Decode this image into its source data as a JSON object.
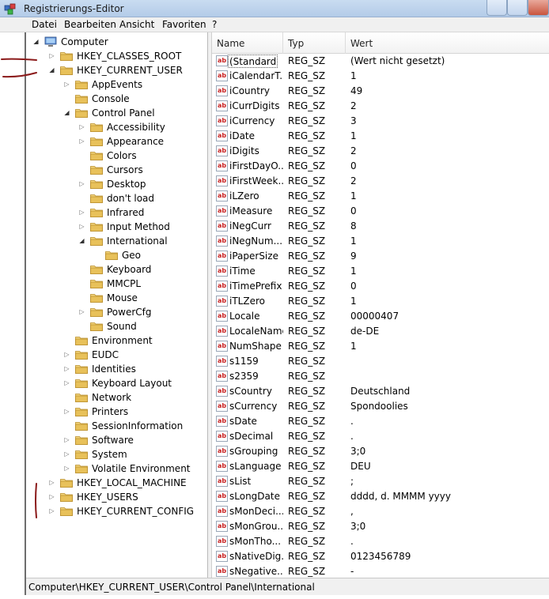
{
  "window": {
    "title": "Registrierungs-Editor"
  },
  "menu": [
    "Datei",
    "Bearbeiten",
    "Ansicht",
    "Favoriten",
    "?"
  ],
  "tree": [
    {
      "label": "Computer",
      "depth": 0,
      "expander": "open",
      "icon": "computer-icon"
    },
    {
      "label": "HKEY_CLASSES_ROOT",
      "depth": 1,
      "expander": "closed",
      "icon": "folder-icon"
    },
    {
      "label": "HKEY_CURRENT_USER",
      "depth": 1,
      "expander": "open",
      "icon": "folder-icon"
    },
    {
      "label": "AppEvents",
      "depth": 2,
      "expander": "closed",
      "icon": "folder-icon"
    },
    {
      "label": "Console",
      "depth": 2,
      "expander": "none",
      "icon": "folder-icon"
    },
    {
      "label": "Control Panel",
      "depth": 2,
      "expander": "open",
      "icon": "folder-icon"
    },
    {
      "label": "Accessibility",
      "depth": 3,
      "expander": "closed",
      "icon": "folder-icon"
    },
    {
      "label": "Appearance",
      "depth": 3,
      "expander": "closed",
      "icon": "folder-icon"
    },
    {
      "label": "Colors",
      "depth": 3,
      "expander": "none",
      "icon": "folder-icon"
    },
    {
      "label": "Cursors",
      "depth": 3,
      "expander": "none",
      "icon": "folder-icon"
    },
    {
      "label": "Desktop",
      "depth": 3,
      "expander": "closed",
      "icon": "folder-icon"
    },
    {
      "label": "don't load",
      "depth": 3,
      "expander": "none",
      "icon": "folder-icon"
    },
    {
      "label": "Infrared",
      "depth": 3,
      "expander": "closed",
      "icon": "folder-icon"
    },
    {
      "label": "Input Method",
      "depth": 3,
      "expander": "closed",
      "icon": "folder-icon"
    },
    {
      "label": "International",
      "depth": 3,
      "expander": "open",
      "icon": "folder-icon"
    },
    {
      "label": "Geo",
      "depth": 4,
      "expander": "none",
      "icon": "folder-icon"
    },
    {
      "label": "Keyboard",
      "depth": 3,
      "expander": "none",
      "icon": "folder-icon"
    },
    {
      "label": "MMCPL",
      "depth": 3,
      "expander": "none",
      "icon": "folder-icon"
    },
    {
      "label": "Mouse",
      "depth": 3,
      "expander": "none",
      "icon": "folder-icon"
    },
    {
      "label": "PowerCfg",
      "depth": 3,
      "expander": "closed",
      "icon": "folder-icon"
    },
    {
      "label": "Sound",
      "depth": 3,
      "expander": "none",
      "icon": "folder-icon"
    },
    {
      "label": "Environment",
      "depth": 2,
      "expander": "none",
      "icon": "folder-icon"
    },
    {
      "label": "EUDC",
      "depth": 2,
      "expander": "closed",
      "icon": "folder-icon"
    },
    {
      "label": "Identities",
      "depth": 2,
      "expander": "closed",
      "icon": "folder-icon"
    },
    {
      "label": "Keyboard Layout",
      "depth": 2,
      "expander": "closed",
      "icon": "folder-icon"
    },
    {
      "label": "Network",
      "depth": 2,
      "expander": "none",
      "icon": "folder-icon"
    },
    {
      "label": "Printers",
      "depth": 2,
      "expander": "closed",
      "icon": "folder-icon"
    },
    {
      "label": "SessionInformation",
      "depth": 2,
      "expander": "none",
      "icon": "folder-icon"
    },
    {
      "label": "Software",
      "depth": 2,
      "expander": "closed",
      "icon": "folder-icon"
    },
    {
      "label": "System",
      "depth": 2,
      "expander": "closed",
      "icon": "folder-icon"
    },
    {
      "label": "Volatile Environment",
      "depth": 2,
      "expander": "closed",
      "icon": "folder-icon"
    },
    {
      "label": "HKEY_LOCAL_MACHINE",
      "depth": 1,
      "expander": "closed",
      "icon": "folder-icon"
    },
    {
      "label": "HKEY_USERS",
      "depth": 1,
      "expander": "closed",
      "icon": "folder-icon"
    },
    {
      "label": "HKEY_CURRENT_CONFIG",
      "depth": 1,
      "expander": "closed",
      "icon": "folder-icon"
    }
  ],
  "list": {
    "columns": [
      "Name",
      "Typ",
      "Wert"
    ],
    "rows": [
      {
        "name": "(Standard)",
        "type": "REG_SZ",
        "value": "(Wert nicht gesetzt)"
      },
      {
        "name": "iCalendarT...",
        "type": "REG_SZ",
        "value": "1"
      },
      {
        "name": "iCountry",
        "type": "REG_SZ",
        "value": "49"
      },
      {
        "name": "iCurrDigits",
        "type": "REG_SZ",
        "value": "2"
      },
      {
        "name": "iCurrency",
        "type": "REG_SZ",
        "value": "3"
      },
      {
        "name": "iDate",
        "type": "REG_SZ",
        "value": "1"
      },
      {
        "name": "iDigits",
        "type": "REG_SZ",
        "value": "2"
      },
      {
        "name": "iFirstDayO...",
        "type": "REG_SZ",
        "value": "0"
      },
      {
        "name": "iFirstWeek...",
        "type": "REG_SZ",
        "value": "2"
      },
      {
        "name": "iLZero",
        "type": "REG_SZ",
        "value": "1"
      },
      {
        "name": "iMeasure",
        "type": "REG_SZ",
        "value": "0"
      },
      {
        "name": "iNegCurr",
        "type": "REG_SZ",
        "value": "8"
      },
      {
        "name": "iNegNum...",
        "type": "REG_SZ",
        "value": "1"
      },
      {
        "name": "iPaperSize",
        "type": "REG_SZ",
        "value": "9"
      },
      {
        "name": "iTime",
        "type": "REG_SZ",
        "value": "1"
      },
      {
        "name": "iTimePrefix",
        "type": "REG_SZ",
        "value": "0"
      },
      {
        "name": "iTLZero",
        "type": "REG_SZ",
        "value": "1"
      },
      {
        "name": "Locale",
        "type": "REG_SZ",
        "value": "00000407"
      },
      {
        "name": "LocaleName",
        "type": "REG_SZ",
        "value": "de-DE"
      },
      {
        "name": "NumShape",
        "type": "REG_SZ",
        "value": "1"
      },
      {
        "name": "s1159",
        "type": "REG_SZ",
        "value": ""
      },
      {
        "name": "s2359",
        "type": "REG_SZ",
        "value": ""
      },
      {
        "name": "sCountry",
        "type": "REG_SZ",
        "value": "Deutschland"
      },
      {
        "name": "sCurrency",
        "type": "REG_SZ",
        "value": "Spondoolies"
      },
      {
        "name": "sDate",
        "type": "REG_SZ",
        "value": "."
      },
      {
        "name": "sDecimal",
        "type": "REG_SZ",
        "value": "."
      },
      {
        "name": "sGrouping",
        "type": "REG_SZ",
        "value": "3;0"
      },
      {
        "name": "sLanguage",
        "type": "REG_SZ",
        "value": "DEU"
      },
      {
        "name": "sList",
        "type": "REG_SZ",
        "value": ";"
      },
      {
        "name": "sLongDate",
        "type": "REG_SZ",
        "value": "dddd, d. MMMM yyyy"
      },
      {
        "name": "sMonDeci...",
        "type": "REG_SZ",
        "value": ","
      },
      {
        "name": "sMonGrou...",
        "type": "REG_SZ",
        "value": "3;0"
      },
      {
        "name": "sMonTho...",
        "type": "REG_SZ",
        "value": "."
      },
      {
        "name": "sNativeDig...",
        "type": "REG_SZ",
        "value": "0123456789"
      },
      {
        "name": "sNegative...",
        "type": "REG_SZ",
        "value": "-"
      }
    ]
  },
  "status": {
    "path": "Computer\\HKEY_CURRENT_USER\\Control Panel\\International"
  },
  "colors": {
    "annotation": "#8b1a1a",
    "folder": "#e8c15a",
    "icon_text": "#c82020"
  }
}
